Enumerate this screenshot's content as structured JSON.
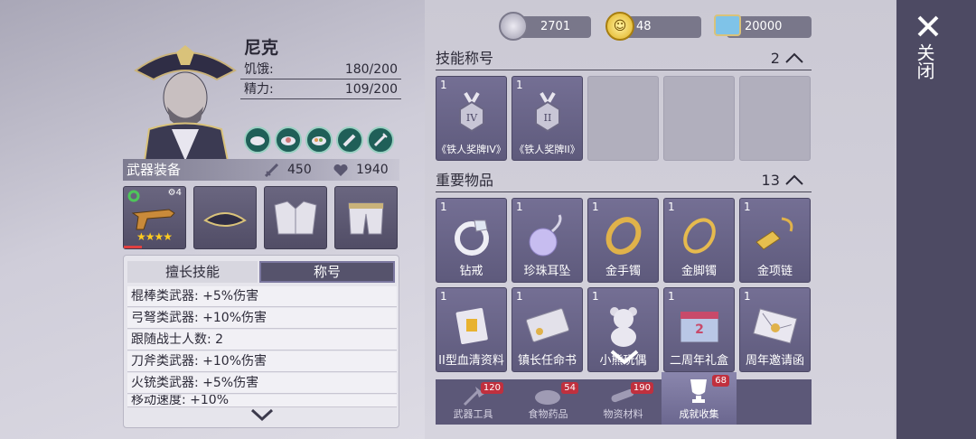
{
  "currency": [
    {
      "icon": "silver-coin-icon",
      "value": "2701"
    },
    {
      "icon": "gold-coin-icon",
      "value": "48"
    },
    {
      "icon": "ticket-icon",
      "value": "20000"
    }
  ],
  "character": {
    "name": "尼克",
    "stats": [
      {
        "label": "饥饿:",
        "value": "180/200"
      },
      {
        "label": "精力:",
        "value": "109/200"
      }
    ]
  },
  "equipment": {
    "title": "武器装备",
    "attack": "450",
    "health": "1940",
    "weapon_level": "4",
    "weapon_stars": "★★★★"
  },
  "skills": {
    "tabs": [
      "擅长技能",
      "称号"
    ],
    "active_tab": "称号",
    "rows": [
      "棍棒类武器: +5%伤害",
      "弓弩类武器: +10%伤害",
      "跟随战士人数: 2",
      "刀斧类武器: +10%伤害",
      "火铳类武器: +5%伤害",
      "移动速度: +10%"
    ]
  },
  "titles_section": {
    "label": "技能称号",
    "count": "2",
    "items": [
      {
        "count": "1",
        "name": "《铁人奖牌IV》",
        "icon": "medal-iv-icon"
      },
      {
        "count": "1",
        "name": "《铁人奖牌II》",
        "icon": "medal-ii-icon"
      }
    ]
  },
  "important_section": {
    "label": "重要物品",
    "count": "13",
    "items": [
      {
        "count": "1",
        "name": "钻戒",
        "icon": "diamond-ring-icon"
      },
      {
        "count": "1",
        "name": "珍珠耳坠",
        "icon": "pearl-earring-icon"
      },
      {
        "count": "1",
        "name": "金手镯",
        "icon": "gold-bracelet-icon"
      },
      {
        "count": "1",
        "name": "金脚镯",
        "icon": "gold-anklet-icon"
      },
      {
        "count": "1",
        "name": "金项链",
        "icon": "gold-necklace-icon"
      },
      {
        "count": "1",
        "name": "II型血清资料",
        "icon": "serum-document-icon"
      },
      {
        "count": "1",
        "name": "镇长任命书",
        "icon": "appointment-letter-icon"
      },
      {
        "count": "1",
        "name": "小熊玩偶",
        "icon": "teddy-bear-icon"
      },
      {
        "count": "1",
        "name": "二周年礼盒",
        "icon": "gift-box-icon"
      },
      {
        "count": "1",
        "name": "周年邀请函",
        "icon": "invitation-icon"
      }
    ]
  },
  "bottom_tabs": [
    {
      "label": "武器工具",
      "badge": "120"
    },
    {
      "label": "食物药品",
      "badge": "54"
    },
    {
      "label": "物资材料",
      "badge": "190"
    },
    {
      "label": "成就收集",
      "badge": "68"
    }
  ],
  "close_label": "关闭"
}
